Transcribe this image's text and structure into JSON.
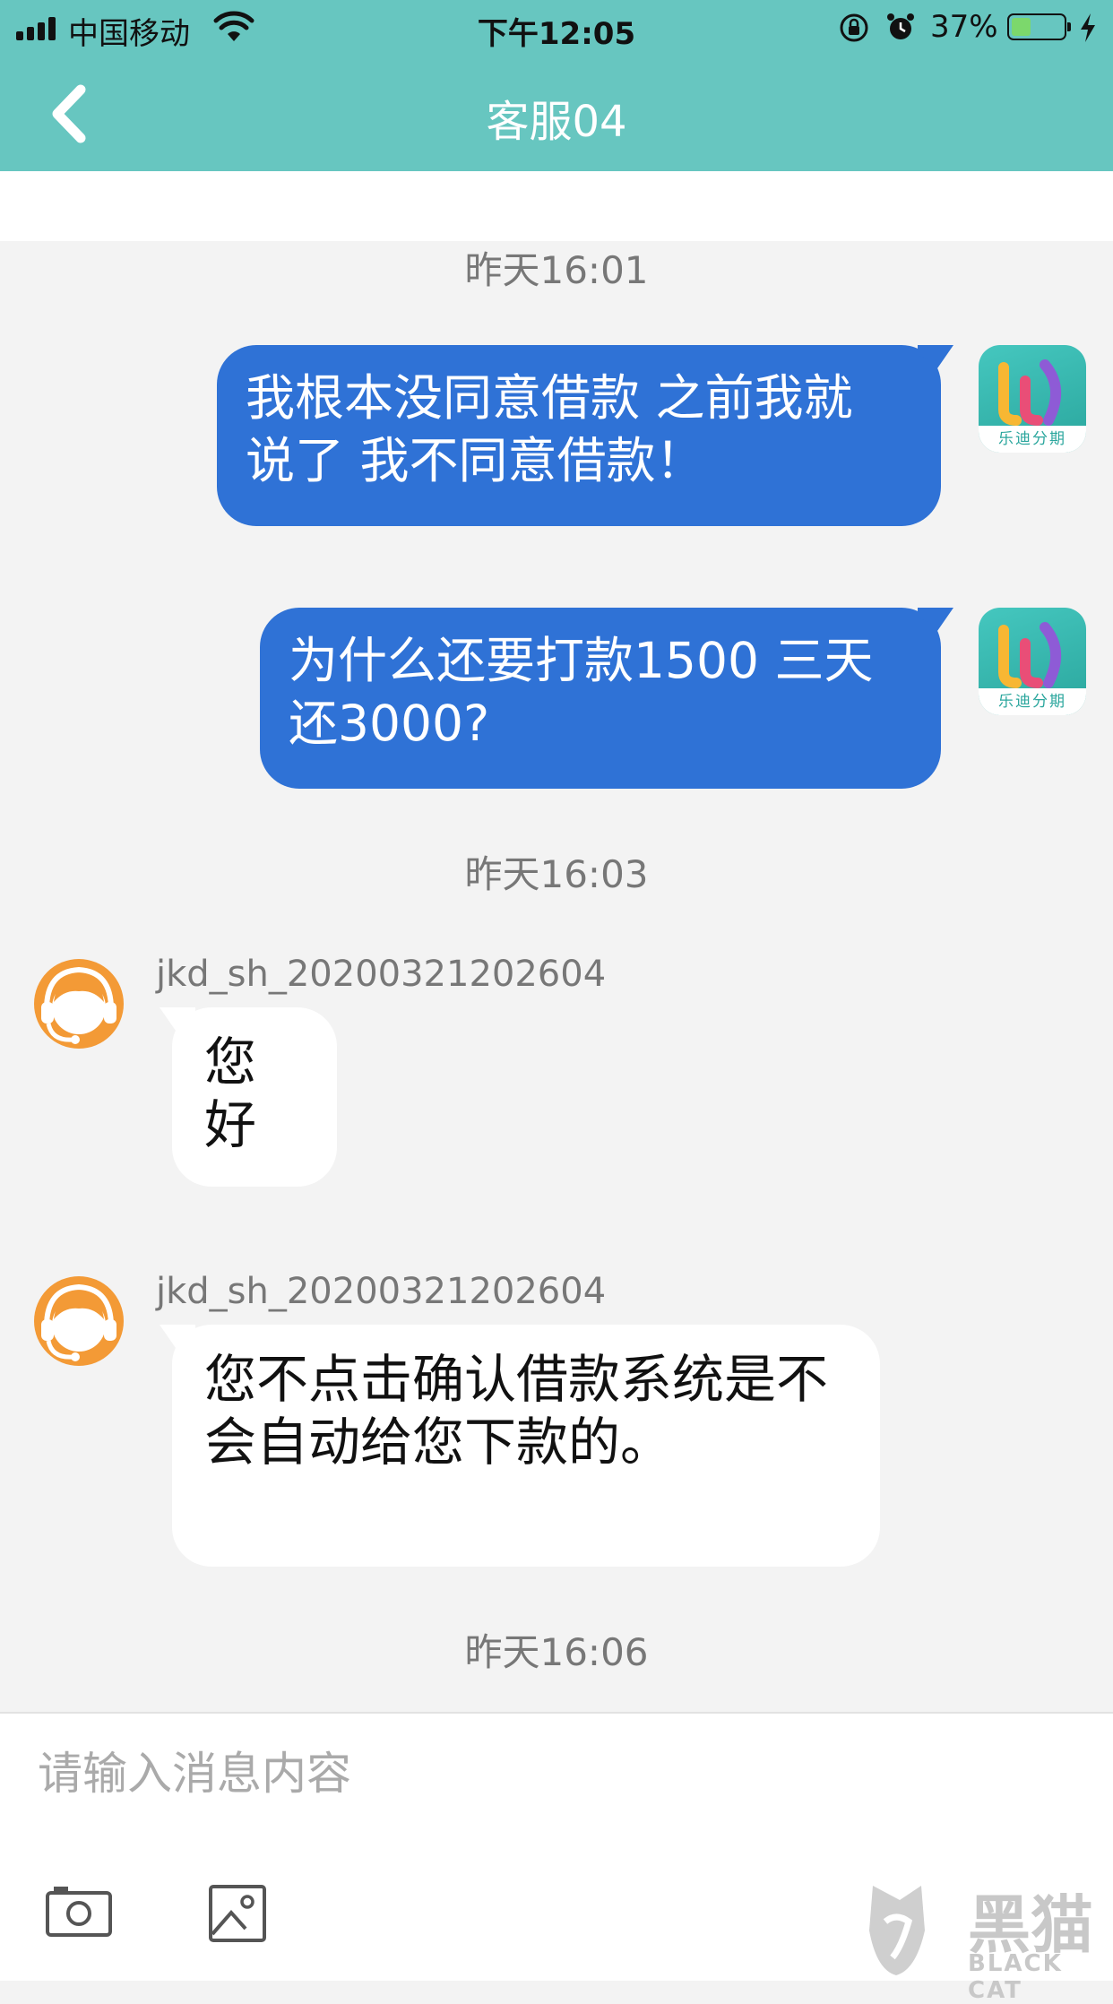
{
  "status_bar": {
    "carrier": "中国移动",
    "time": "下午12:05",
    "battery_percent_text": "37%",
    "battery_level": 0.37
  },
  "nav": {
    "title": "客服04"
  },
  "app_avatar": {
    "caption": "乐迪分期"
  },
  "messages": [
    {
      "type": "timestamp",
      "text": "昨天16:01"
    },
    {
      "type": "outgoing",
      "lines": [
        "我根本没同意借款 之前我就",
        "说了 我不同意借款！"
      ]
    },
    {
      "type": "outgoing",
      "lines": [
        "为什么还要打款1500 三天",
        "还3000?"
      ]
    },
    {
      "type": "timestamp",
      "text": "昨天16:03"
    },
    {
      "type": "incoming",
      "sender": "jkd_sh_20200321202604",
      "lines": [
        "您好"
      ]
    },
    {
      "type": "incoming",
      "sender": "jkd_sh_20200321202604",
      "lines": [
        "您不点击确认借款系统是不",
        "会自动给您下款的。"
      ]
    },
    {
      "type": "timestamp",
      "text": "昨天16:06"
    }
  ],
  "input": {
    "placeholder": "请输入消息内容"
  },
  "watermark": {
    "cn": "黑猫",
    "en": "BLACK CAT"
  },
  "colors": {
    "header": "#67c6c0",
    "outgoing_bubble": "#2f72d6",
    "incoming_bubble": "#ffffff",
    "chat_background": "#f3f3f3",
    "agent_avatar": "#f39a36"
  }
}
